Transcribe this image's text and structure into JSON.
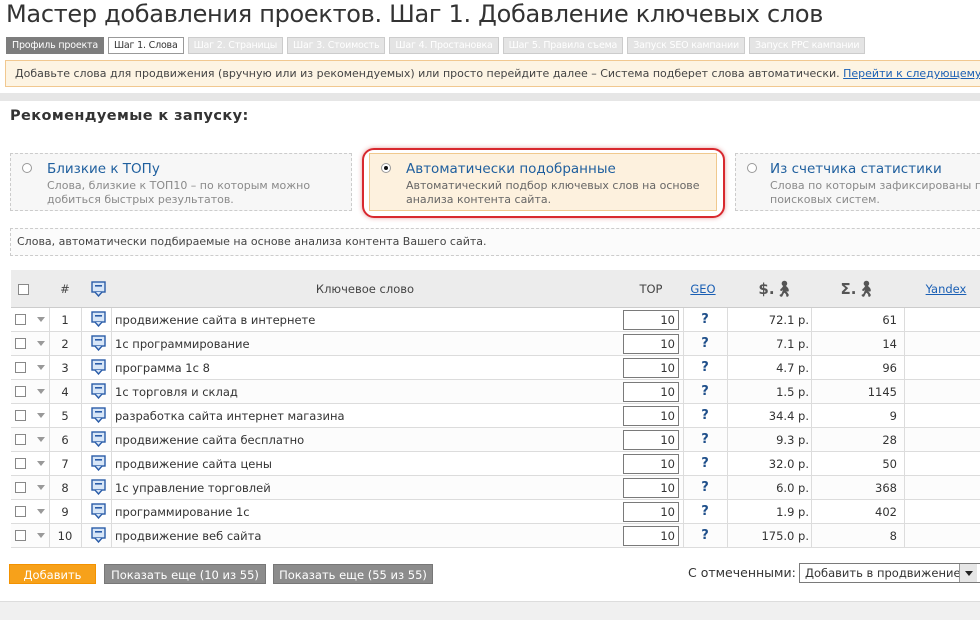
{
  "page": {
    "title": "Мастер добавления проектов. Шаг 1. Добавление ключевых слов"
  },
  "tabs": [
    {
      "label": "Профиль проекта",
      "state": "done"
    },
    {
      "label": "Шаг 1. Слова",
      "state": "active"
    },
    {
      "label": "Шаг 2. Страницы",
      "state": "disabled"
    },
    {
      "label": "Шаг 3. Стоимость",
      "state": "disabled"
    },
    {
      "label": "Шаг 4. Простановка",
      "state": "disabled"
    },
    {
      "label": "Шаг 5. Правила съема",
      "state": "disabled"
    },
    {
      "label": "Запуск SEO кампании",
      "state": "disabled"
    },
    {
      "label": "Запуск PPC кампании",
      "state": "disabled"
    }
  ],
  "notice": {
    "text": "Добавьте слова для продвижения (вручную или из рекомендуемых) или просто перейдите далее – Система подберет слова автоматически.",
    "link": "Перейти к следующему шагу"
  },
  "recommended": {
    "title": "Рекомендуемые к запуску:",
    "options": [
      {
        "title": "Близкие к ТОПу",
        "desc1": "Слова, близкие к ТОП10 – по которым можно",
        "desc2": "добиться быстрых результатов.",
        "selected": false
      },
      {
        "title": "Автоматически подобранные",
        "desc1": "Автоматический подбор ключевых слов на основе",
        "desc2": "анализа контента сайта.",
        "selected": true
      },
      {
        "title": "Из счетчика статистики",
        "desc1": "Слова по которым зафиксированы п",
        "desc2": "поисковых систем.",
        "selected": false
      }
    ],
    "hint": "Слова, автоматически подбираемые на основе анализа контента Вашего сайта."
  },
  "table": {
    "headers": {
      "num": "#",
      "keyword": "Ключевое слово",
      "top": "TOP",
      "geo": "GEO",
      "price": "$.",
      "sum": "Σ.",
      "yandex": "Yandex"
    },
    "rows": [
      {
        "n": "1",
        "keyword": "продвижение сайта в интернете",
        "top": "10",
        "geo": "?",
        "price": "72.1 р.",
        "count": "61"
      },
      {
        "n": "2",
        "keyword": "1с программирование",
        "top": "10",
        "geo": "?",
        "price": "7.1 р.",
        "count": "14"
      },
      {
        "n": "3",
        "keyword": "программа 1с 8",
        "top": "10",
        "geo": "?",
        "price": "4.7 р.",
        "count": "96"
      },
      {
        "n": "4",
        "keyword": "1с торговля и склад",
        "top": "10",
        "geo": "?",
        "price": "1.5 р.",
        "count": "1145"
      },
      {
        "n": "5",
        "keyword": "разработка сайта интернет магазина",
        "top": "10",
        "geo": "?",
        "price": "34.4 р.",
        "count": "9"
      },
      {
        "n": "6",
        "keyword": "продвижение сайта бесплатно",
        "top": "10",
        "geo": "?",
        "price": "9.3 р.",
        "count": "28"
      },
      {
        "n": "7",
        "keyword": "продвижение сайта цены",
        "top": "10",
        "geo": "?",
        "price": "32.0 р.",
        "count": "50"
      },
      {
        "n": "8",
        "keyword": "1с управление торговлей",
        "top": "10",
        "geo": "?",
        "price": "6.0 р.",
        "count": "368"
      },
      {
        "n": "9",
        "keyword": "программирование 1с",
        "top": "10",
        "geo": "?",
        "price": "1.9 р.",
        "count": "402"
      },
      {
        "n": "10",
        "keyword": "продвижение веб сайта",
        "top": "10",
        "geo": "?",
        "price": "175.0 р.",
        "count": "8"
      }
    ]
  },
  "actions": {
    "add": "Добавить",
    "show_more_10": "Показать еще (10 из 55)",
    "show_more_55": "Показать еще (55 из 55)",
    "with_selected": "С отмеченными:",
    "bulk_action": "Добавить в продвижение"
  },
  "colors": {
    "accent_orange": "#f7a11a",
    "link_blue": "#1a5fb4",
    "highlight_red": "#d8282e"
  }
}
